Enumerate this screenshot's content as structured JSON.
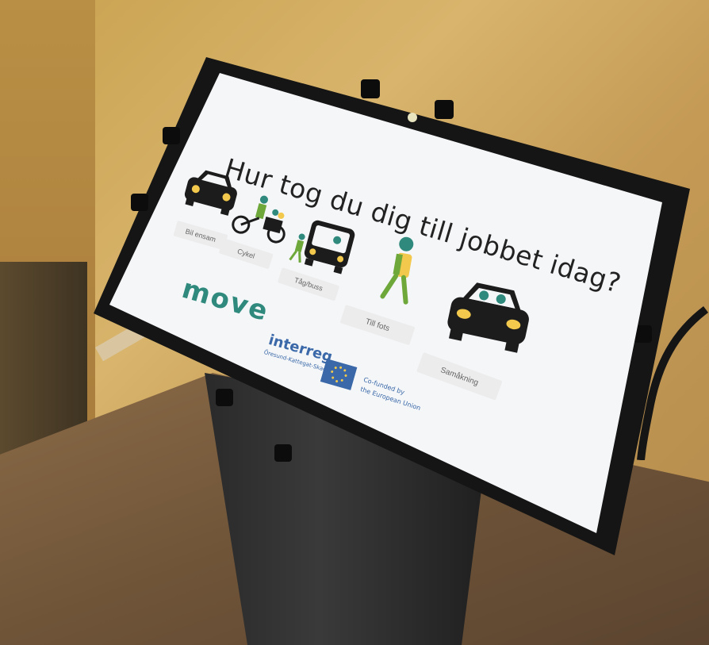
{
  "kiosk": {
    "question": "Hur tog du dig till jobbet idag?",
    "options": [
      {
        "label": "Bil ensam",
        "icon": "car-icon"
      },
      {
        "label": "Cykel",
        "icon": "bicycle-icon"
      },
      {
        "label": "Tåg/buss",
        "icon": "bus-icon"
      },
      {
        "label": "Till fots",
        "icon": "walking-person-icon"
      },
      {
        "label": "Samåkning",
        "icon": "carpool-icon"
      }
    ],
    "logo_move": "move",
    "interreg": {
      "name": "interreg",
      "region": "Öresund-Kattegat-Skagerrak",
      "cofunded_line1": "Co-funded by",
      "cofunded_line2": "the European Union"
    }
  },
  "colors": {
    "accent_green": "#6fa83a",
    "teal": "#2f8a7d",
    "screen_bg": "#f4f6f8",
    "button_bg": "#ececec"
  }
}
